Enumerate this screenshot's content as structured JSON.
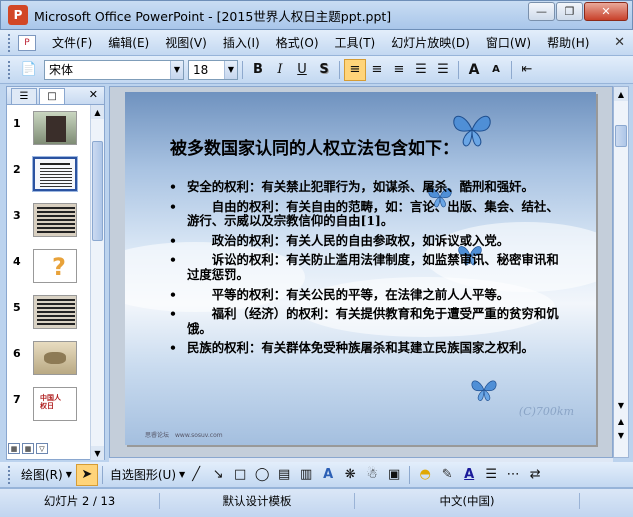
{
  "window": {
    "title": "Microsoft Office PowerPoint - [2015世界人权日主题ppt.ppt]",
    "app_icon": "P"
  },
  "menubar": {
    "items": [
      "文件(F)",
      "编辑(E)",
      "视图(V)",
      "插入(I)",
      "格式(O)",
      "工具(T)",
      "幻灯片放映(D)",
      "窗口(W)",
      "帮助(H)"
    ]
  },
  "toolbar": {
    "font": "宋体",
    "size": "18",
    "bold": "B",
    "italic": "I",
    "underline": "U",
    "shadow": "S",
    "grow": "A",
    "shrink": "A"
  },
  "left_pane": {
    "slide_numbers": [
      "1",
      "2",
      "3",
      "4",
      "5",
      "6",
      "7"
    ],
    "selected": "2",
    "slide7_text": "中国人权日"
  },
  "slide": {
    "title": "被多数国家认同的人权立法包含如下：",
    "bullets": [
      "安全的权利：有关禁止犯罪行为，如谋杀、屠杀、酷刑和强奸。",
      "　　自由的权利：有关自由的范畴，如：言论、出版、集会、结社、游行、示威以及宗教信仰的自由[1]。",
      "　　政治的权利：有关人民的自由参政权，如诉议或入党。",
      "　　诉讼的权利：有关防止滥用法律制度，如监禁审讯、秘密审讯和过度惩罚。",
      "　　平等的权利：有关公民的平等，在法律之前人人平等。",
      "　　福利（经济）的权利：有关提供教育和免于遭受严重的贫穷和饥饿。",
      "民族的权利：有关群体免受种族屠杀和其建立民族国家之权利。"
    ],
    "watermark": "(C)700km",
    "footnote": "思睿论坛　www.sosuv.com"
  },
  "drawbar": {
    "draw": "绘图(R)",
    "autoshapes": "自选图形(U)"
  },
  "statusbar": {
    "slide": "幻灯片 2 / 13",
    "design": "默认设计模板",
    "language": "中文(中国)"
  }
}
